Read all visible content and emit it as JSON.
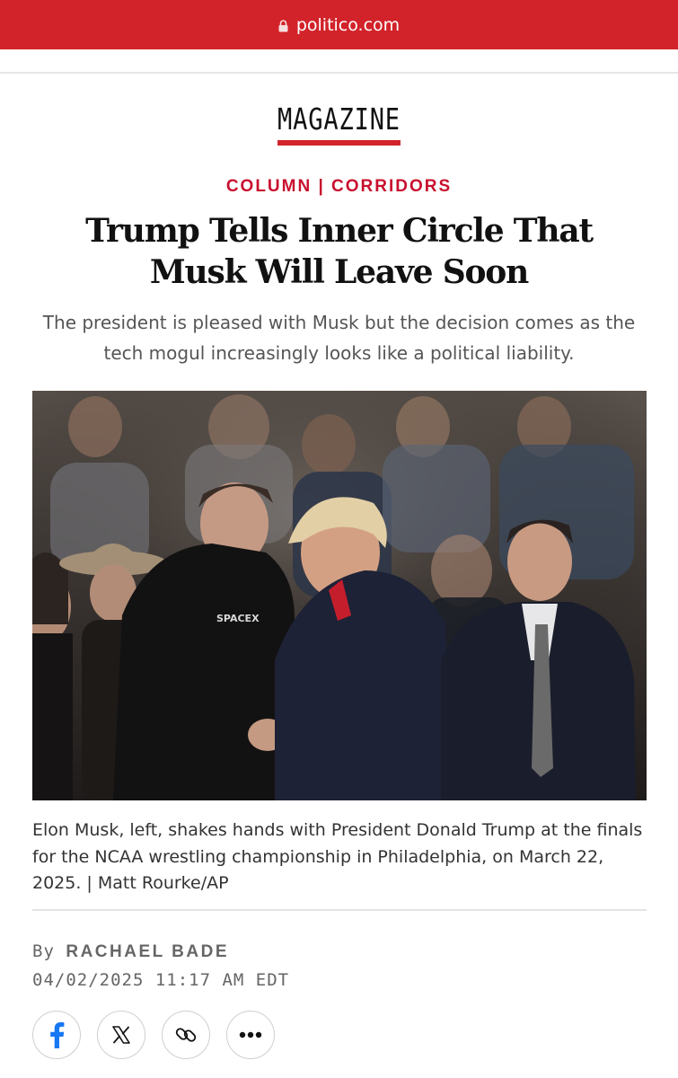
{
  "browser": {
    "url": "politico.com"
  },
  "section": {
    "label": "MAGAZINE"
  },
  "article": {
    "kicker": "COLUMN | CORRIDORS",
    "headline": "Trump Tells Inner Circle That Musk Will Leave Soon",
    "dek": "The president is pleased with Musk but the decision comes as the tech mogul increasingly looks like a political liability.",
    "photo": {
      "shirt_text": "SPACEX",
      "caption": "Elon Musk, left, shakes hands with President Donald Trump at the finals for the NCAA wrestling championship in Philadelphia, on March 22, 2025. | Matt Rourke/AP"
    },
    "byline_prefix": "By",
    "author": "RACHAEL BADE",
    "timestamp": "04/02/2025 11:17 AM EDT"
  },
  "share_buttons": [
    {
      "icon": "facebook-icon"
    },
    {
      "icon": "x-icon"
    },
    {
      "icon": "link-icon"
    },
    {
      "icon": "more-icon"
    }
  ],
  "colors": {
    "brand_red": "#d2232a",
    "kicker_red": "#c8102e",
    "text": "#111111",
    "muted": "#666666"
  }
}
